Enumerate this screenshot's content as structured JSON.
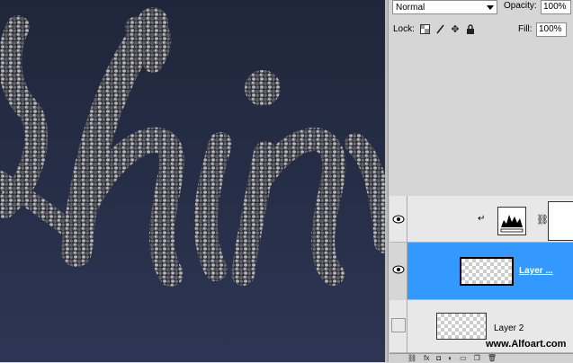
{
  "layers_panel": {
    "blend_mode": "Normal",
    "opacity_label": "Opacity:",
    "opacity_value": "100%",
    "lock_label": "Lock:",
    "fill_label": "Fill:",
    "fill_value": "100%",
    "layers": [
      {
        "name": "",
        "type": "adjustment-levels",
        "visible": true,
        "selected": false
      },
      {
        "name": "Layer ...",
        "visible": true,
        "selected": true
      },
      {
        "name": "Layer 2",
        "visible": false,
        "selected": false
      }
    ]
  },
  "watermark": "www.Alfoart.com",
  "bottom_icons": [
    "link-icon",
    "fx-icon",
    "mask-icon",
    "adjustment-icon",
    "folder-icon",
    "new-layer-icon",
    "trash-icon"
  ],
  "colors": {
    "canvas_bg": "#262f48",
    "selected_layer": "#3399ff",
    "panel_bg": "#d6d6d6"
  }
}
